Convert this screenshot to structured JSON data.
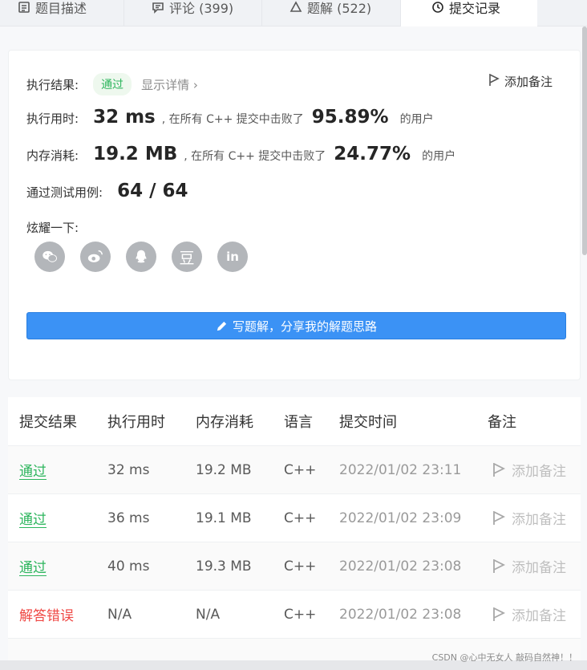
{
  "tabs": [
    {
      "label": "题目描述",
      "icon": "file-text-icon"
    },
    {
      "label": "评论 (399)",
      "icon": "comment-icon"
    },
    {
      "label": "题解 (522)",
      "icon": "triangle-icon"
    },
    {
      "label": "提交记录",
      "icon": "clock-icon"
    }
  ],
  "result": {
    "status_label": "执行结果:",
    "status_value": "通过",
    "details_link": "显示详情 ›",
    "add_note": "添加备注",
    "time_label": "执行用时:",
    "time_value": "32 ms",
    "time_mid": ", 在所有 C++ 提交中击败了",
    "time_pct": "95.89%",
    "time_suffix": "的用户",
    "mem_label": "内存消耗:",
    "mem_value": "19.2 MB",
    "mem_mid": ", 在所有 C++ 提交中击败了",
    "mem_pct": "24.77%",
    "mem_suffix": "的用户",
    "tests_label": "通过测试用例:",
    "tests_value": "64 / 64",
    "share_label": "炫耀一下:",
    "share_icons": [
      "wechat-icon",
      "weibo-icon",
      "qq-icon",
      "douban-icon",
      "linkedin-icon"
    ],
    "douban_glyph": "豆",
    "linkedin_glyph": "in",
    "write_button": "写题解，分享我的解题思路"
  },
  "table": {
    "headers": [
      "提交结果",
      "执行用时",
      "内存消耗",
      "语言",
      "提交时间",
      "备注"
    ],
    "rows": [
      {
        "result": "通过",
        "time": "32 ms",
        "mem": "19.2 MB",
        "lang": "C++",
        "date": "2022/01/02 23:11",
        "note": "添加备注"
      },
      {
        "result": "通过",
        "time": "36 ms",
        "mem": "19.1 MB",
        "lang": "C++",
        "date": "2022/01/02 23:09",
        "note": "添加备注"
      },
      {
        "result": "通过",
        "time": "40 ms",
        "mem": "19.3 MB",
        "lang": "C++",
        "date": "2022/01/02 23:08",
        "note": "添加备注"
      },
      {
        "result": "解答错误",
        "time": "N/A",
        "mem": "N/A",
        "lang": "C++",
        "date": "2022/01/02 23:08",
        "note": "添加备注"
      }
    ]
  },
  "watermark": "CSDN @心中无女人 敲码自然神！！",
  "colors": {
    "accent": "#3b92f5",
    "success": "#2db55d",
    "error": "#ef4743"
  }
}
